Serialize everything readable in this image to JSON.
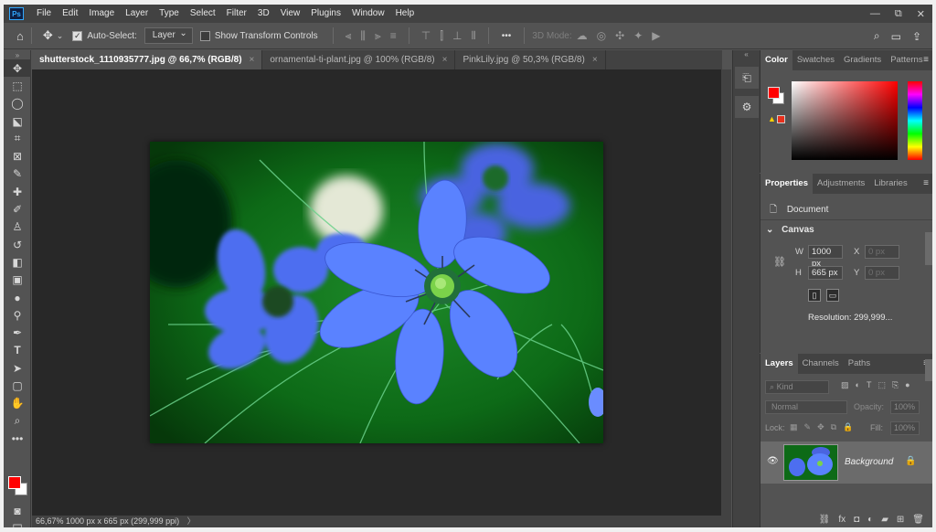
{
  "app": {
    "logo": "Ps"
  },
  "menu": [
    "File",
    "Edit",
    "Image",
    "Layer",
    "Type",
    "Select",
    "Filter",
    "3D",
    "View",
    "Plugins",
    "Window",
    "Help"
  ],
  "window_controls": {
    "minimize": "—",
    "restore": "⧉",
    "close": "✕"
  },
  "options": {
    "auto_select_label": "Auto-Select:",
    "auto_select_checked": true,
    "layer_select": "Layer",
    "transform_label": "Show Transform Controls",
    "transform_checked": false,
    "more": "•••",
    "mode_label": "3D Mode:"
  },
  "tabs": [
    {
      "label": "shutterstock_1110935777.jpg @ 66,7% (RGB/8)",
      "active": true
    },
    {
      "label": "ornamental-ti-plant.jpg @ 100% (RGB/8)",
      "active": false
    },
    {
      "label": "PinkLily.jpg @ 50,3% (RGB/8)",
      "active": false
    }
  ],
  "status": "66,67%   1000 px x 665 px (299,999 ppi)",
  "colors": {
    "foreground": "#ff0000",
    "background": "#ffffff",
    "accent": "#31a8ff"
  },
  "color_panel": {
    "tabs": [
      "Color",
      "Swatches",
      "Gradients",
      "Patterns"
    ]
  },
  "props_panel": {
    "tabs": [
      "Properties",
      "Adjustments",
      "Libraries"
    ],
    "document_label": "Document",
    "canvas_label": "Canvas",
    "w_label": "W",
    "w_value": "1000 px",
    "h_label": "H",
    "h_value": "665 px",
    "x_label": "X",
    "x_value": "0 px",
    "y_label": "Y",
    "y_value": "0 px",
    "resolution": "Resolution: 299,999..."
  },
  "layers_panel": {
    "tabs": [
      "Layers",
      "Channels",
      "Paths"
    ],
    "kind_placeholder": "Kind",
    "blend_mode": "Normal",
    "opacity_label": "Opacity:",
    "opacity_value": "100%",
    "lock_label": "Lock:",
    "fill_label": "Fill:",
    "fill_value": "100%",
    "layer_name": "Background"
  }
}
